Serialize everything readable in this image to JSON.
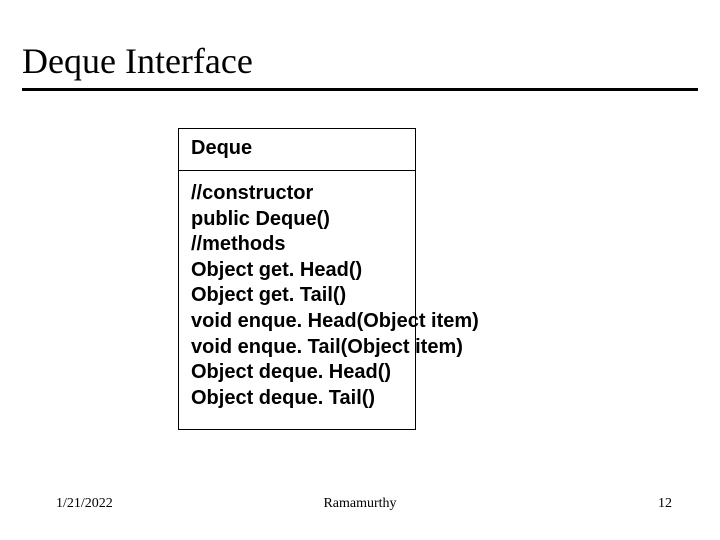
{
  "header": {
    "title": "Deque Interface"
  },
  "diagram": {
    "class_name": "Deque",
    "lines": [
      "//constructor",
      "public Deque()",
      "//methods",
      "Object get. Head()",
      "Object get. Tail()",
      "void enque. Head(Object item)",
      "void enque. Tail(Object item)",
      "Object deque. Head()",
      "Object deque. Tail()"
    ]
  },
  "footer": {
    "date": "1/21/2022",
    "author": "Ramamurthy",
    "page": "12"
  }
}
